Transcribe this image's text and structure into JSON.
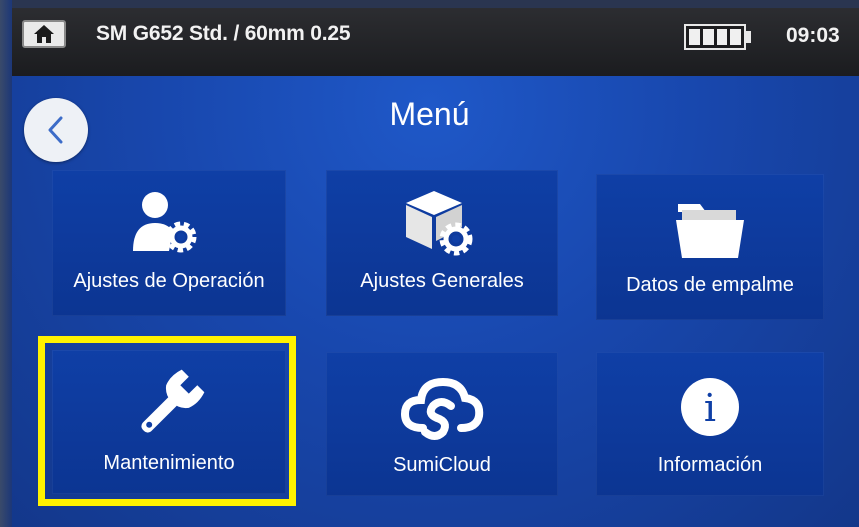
{
  "statusbar": {
    "home_icon": "home-icon",
    "profile": "SM G652 Std. / 60mm 0.25",
    "battery_icon": "battery-icon",
    "battery_level": 1.0,
    "time": "09:03"
  },
  "header": {
    "back_icon": "chevron-left-icon",
    "title": "Menú"
  },
  "menu": {
    "items": [
      {
        "label": "Ajustes de Operación",
        "icon": "user-gear-icon"
      },
      {
        "label": "Ajustes Generales",
        "icon": "box-gear-icon"
      },
      {
        "label": "Datos de empalme",
        "icon": "folder-icon"
      },
      {
        "label": "Mantenimiento",
        "icon": "wrench-icon",
        "highlighted": true
      },
      {
        "label": "SumiCloud",
        "icon": "cloud-icon"
      },
      {
        "label": "Información",
        "icon": "info-icon"
      }
    ]
  },
  "colors": {
    "background": "#1847ad",
    "tile": "#0f3fa6",
    "statusbar": "#222326",
    "highlight": "#fff200"
  }
}
